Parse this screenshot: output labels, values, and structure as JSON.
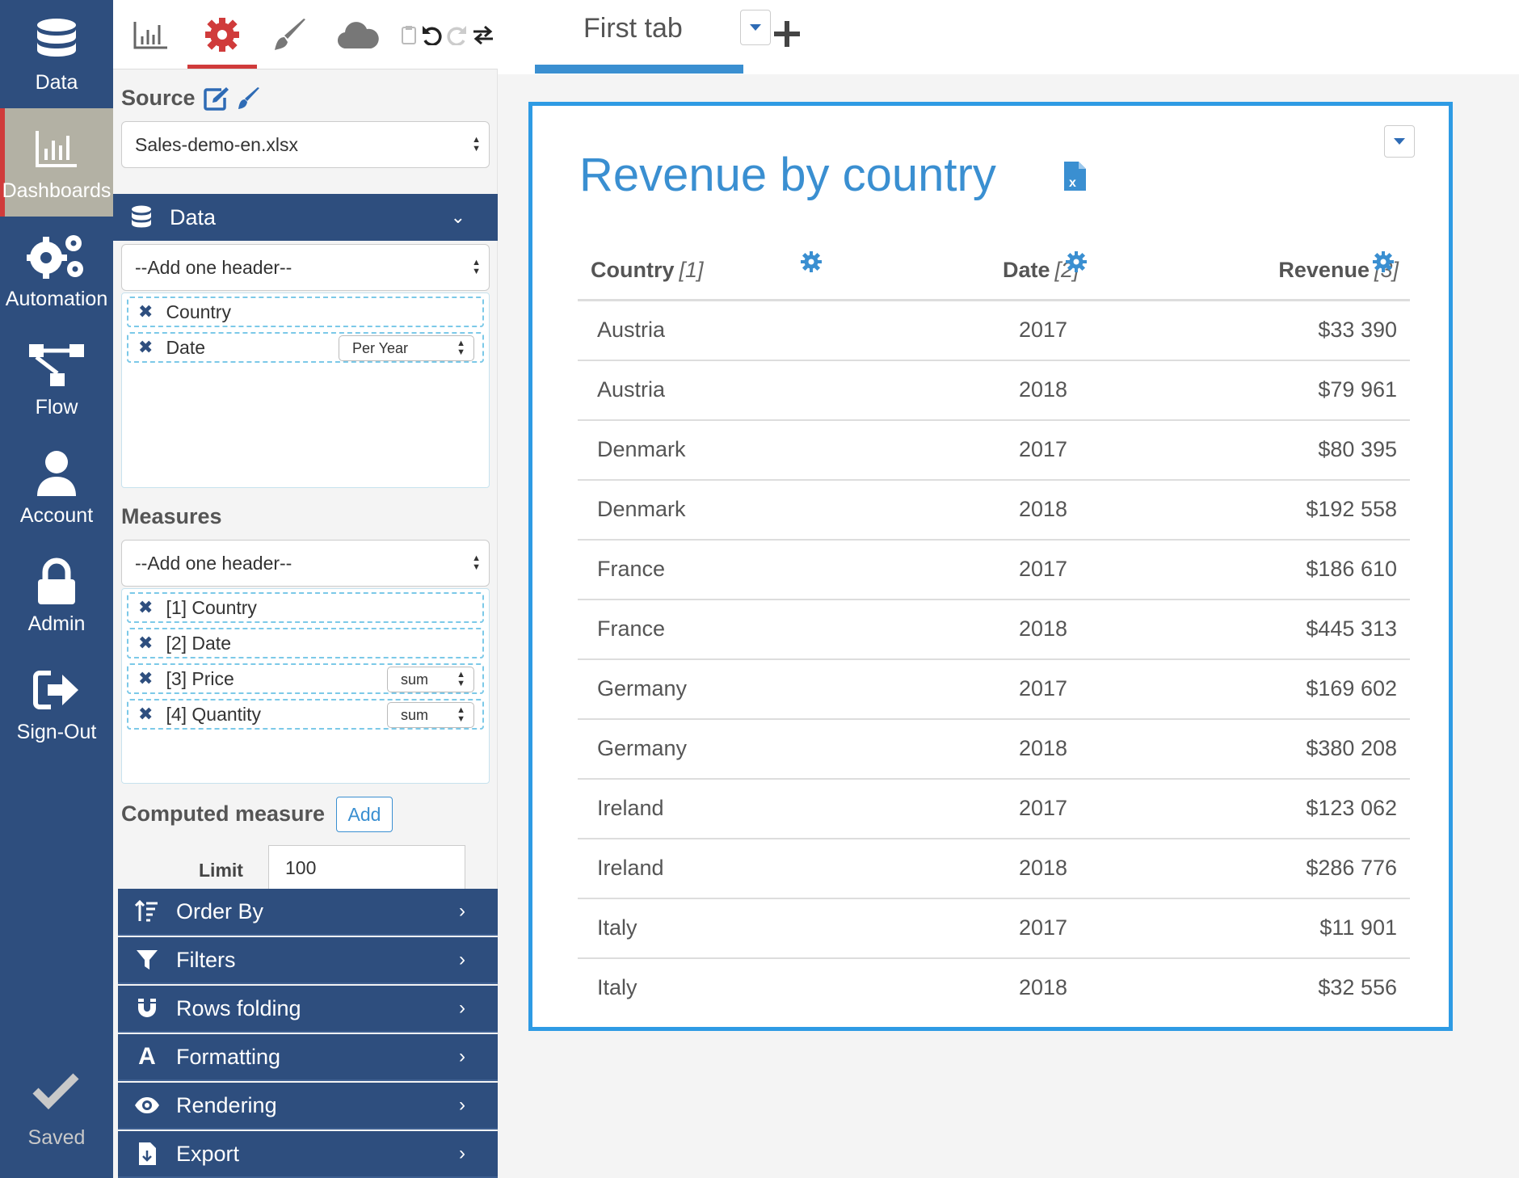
{
  "nav": {
    "items": [
      {
        "label": "Data",
        "icon": "database-icon"
      },
      {
        "label": "Dashboards",
        "icon": "bar-chart-icon",
        "active": true
      },
      {
        "label": "Automation",
        "icon": "gears-icon"
      },
      {
        "label": "Flow",
        "icon": "flow-icon"
      },
      {
        "label": "Account",
        "icon": "user-icon"
      },
      {
        "label": "Admin",
        "icon": "lock-icon"
      },
      {
        "label": "Sign-Out",
        "icon": "sign-out-icon"
      }
    ],
    "saved_label": "Saved"
  },
  "panel": {
    "source_title": "Source",
    "source_value": "Sales-demo-en.xlsx",
    "data_bar": "Data",
    "data_select": "--Add one header--",
    "data_chips": [
      {
        "label": "Country"
      },
      {
        "label": "Date",
        "option": "Per Year"
      }
    ],
    "measures_title": "Measures",
    "measures_select": "--Add one header--",
    "measure_chips": [
      {
        "label": "[1] Country"
      },
      {
        "label": "[2] Date"
      },
      {
        "label": "[3] Price",
        "option": "sum"
      },
      {
        "label": "[4] Quantity",
        "option": "sum"
      }
    ],
    "computed_title": "Computed measure",
    "computed_add": "Add",
    "limit_label": "Limit",
    "limit_value": "100",
    "accordion": [
      {
        "label": "Order By",
        "icon": "sort-icon"
      },
      {
        "label": "Filters",
        "icon": "filter-icon"
      },
      {
        "label": "Rows folding",
        "icon": "magnet-icon"
      },
      {
        "label": "Formatting",
        "icon": "font-icon"
      },
      {
        "label": "Rendering",
        "icon": "eye-icon"
      },
      {
        "label": "Export",
        "icon": "file-export-icon"
      }
    ]
  },
  "tabs": {
    "first_tab": "First tab"
  },
  "widget": {
    "title": "Revenue by country",
    "headers": [
      {
        "label": "Country",
        "index": "[1]"
      },
      {
        "label": "Date",
        "index": "[2]"
      },
      {
        "label": "Revenue",
        "index": "[3]"
      }
    ],
    "rows": [
      [
        "Austria",
        "2017",
        "$33 390"
      ],
      [
        "Austria",
        "2018",
        "$79 961"
      ],
      [
        "Denmark",
        "2017",
        "$80 395"
      ],
      [
        "Denmark",
        "2018",
        "$192 558"
      ],
      [
        "France",
        "2017",
        "$186 610"
      ],
      [
        "France",
        "2018",
        "$445 313"
      ],
      [
        "Germany",
        "2017",
        "$169 602"
      ],
      [
        "Germany",
        "2018",
        "$380 208"
      ],
      [
        "Ireland",
        "2017",
        "$123 062"
      ],
      [
        "Ireland",
        "2018",
        "$286 776"
      ],
      [
        "Italy",
        "2017",
        "$11 901"
      ],
      [
        "Italy",
        "2018",
        "$32 556"
      ]
    ]
  },
  "colors": {
    "nav_bg": "#2e4e7e",
    "accent_blue": "#3a8fd1",
    "accent_red": "#d03b3b",
    "widget_border": "#2e9be4"
  }
}
